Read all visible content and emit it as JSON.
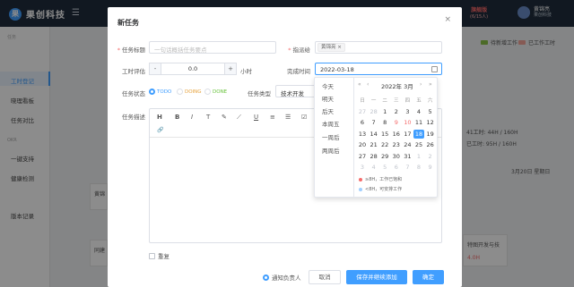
{
  "app": {
    "logo_text": "果",
    "name": "果创科技",
    "collapse_icon": "☰"
  },
  "version": {
    "line1": "旗舰版",
    "line2": "(6/15人)"
  },
  "user": {
    "name": "黄锦亮",
    "company": "果创科技"
  },
  "sidebar": {
    "groups": [
      "任务",
      "OKR"
    ],
    "items": [
      "工时登记",
      "晓理看板",
      "任务对比",
      "一键支持",
      "健康检测",
      "版本记录"
    ]
  },
  "background": {
    "legend": [
      "待新增工作",
      "已工作工时"
    ],
    "legend_colors": [
      "#8bc34a",
      "#f4a59a"
    ],
    "stats": [
      "41工时: 44H / 160H",
      "已工时: 95H / 160H"
    ],
    "dates": [
      "3月20日 星期日"
    ],
    "cards": [
      "黄锦",
      "同建",
      "特图开发与技",
      "4.0H"
    ]
  },
  "dialog": {
    "title": "新任务",
    "close_icon": "×",
    "fields": {
      "task_title": {
        "label": "任务标题",
        "placeholder": "一句话概括任务要点"
      },
      "assignee": {
        "label": "指派给",
        "tag": "黄锦亮",
        "tag_close": "×"
      },
      "hours": {
        "label": "工时评估",
        "value": "0.0",
        "unit": "小时",
        "minus": "-",
        "plus": "+"
      },
      "due": {
        "label": "完成时间",
        "value": "2022-03-18",
        "icon": "calendar-icon"
      },
      "status": {
        "label": "任务状态",
        "options": [
          "TODO",
          "DOING",
          "DONE"
        ],
        "colors": [
          "#409eff",
          "#e6a23c",
          "#67c23a"
        ],
        "selected": "TODO"
      },
      "type": {
        "label": "任务类型",
        "value": "技术开发"
      },
      "desc": {
        "label": "任务描述"
      }
    },
    "toolbar": [
      "H",
      "B",
      "I",
      "T",
      "✎",
      "⟋",
      "U",
      "≡",
      "☰",
      "☑",
      "🔗"
    ],
    "repeat_label": "重复",
    "notify_label": "通知负责人",
    "buttons": {
      "cancel": "取消",
      "save_next": "保存并继续添加",
      "ok": "确定"
    }
  },
  "datepicker": {
    "shortcuts": [
      "今天",
      "明天",
      "后天",
      "本周五",
      "一周后",
      "两周后"
    ],
    "header": "2022年  3月",
    "nav": [
      "«",
      "‹",
      "›",
      "»"
    ],
    "weekdays": [
      "日",
      "一",
      "二",
      "三",
      "四",
      "五",
      "六"
    ],
    "weeks": [
      [
        "27",
        "28",
        "1",
        "2",
        "3",
        "4",
        "5"
      ],
      [
        "6",
        "7",
        "8",
        "9",
        "10",
        "11",
        "12"
      ],
      [
        "13",
        "14",
        "15",
        "16",
        "17",
        "18",
        "19"
      ],
      [
        "20",
        "21",
        "22",
        "23",
        "24",
        "25",
        "26"
      ],
      [
        "27",
        "28",
        "29",
        "30",
        "31",
        "1",
        "2"
      ],
      [
        "3",
        "4",
        "5",
        "6",
        "7",
        "8",
        "9"
      ]
    ],
    "selected": "18",
    "legend": [
      "≥8H，工作已饱和",
      "<8H，可安排工作"
    ],
    "legend_colors": [
      "#f56c6c",
      "#a0cfff"
    ]
  }
}
